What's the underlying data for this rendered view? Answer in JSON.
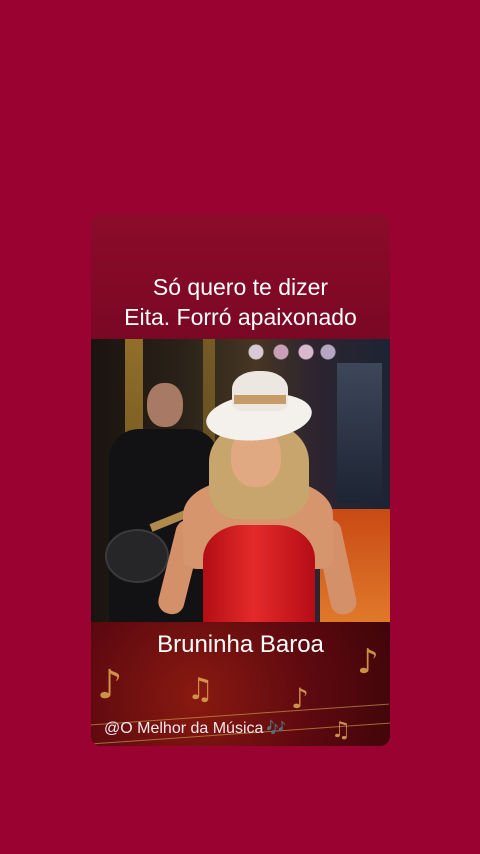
{
  "background_color": "#9a0232",
  "post": {
    "caption_line_1": "Só quero te dizer",
    "caption_line_2": "Eita. Forró apaixonado",
    "artist_name": "Bruninha Baroa",
    "watermark": "@O Melhor da Música",
    "watermark_emoji": "🎶",
    "note_glyph": "♪",
    "note_glyph_alt": "♫"
  }
}
